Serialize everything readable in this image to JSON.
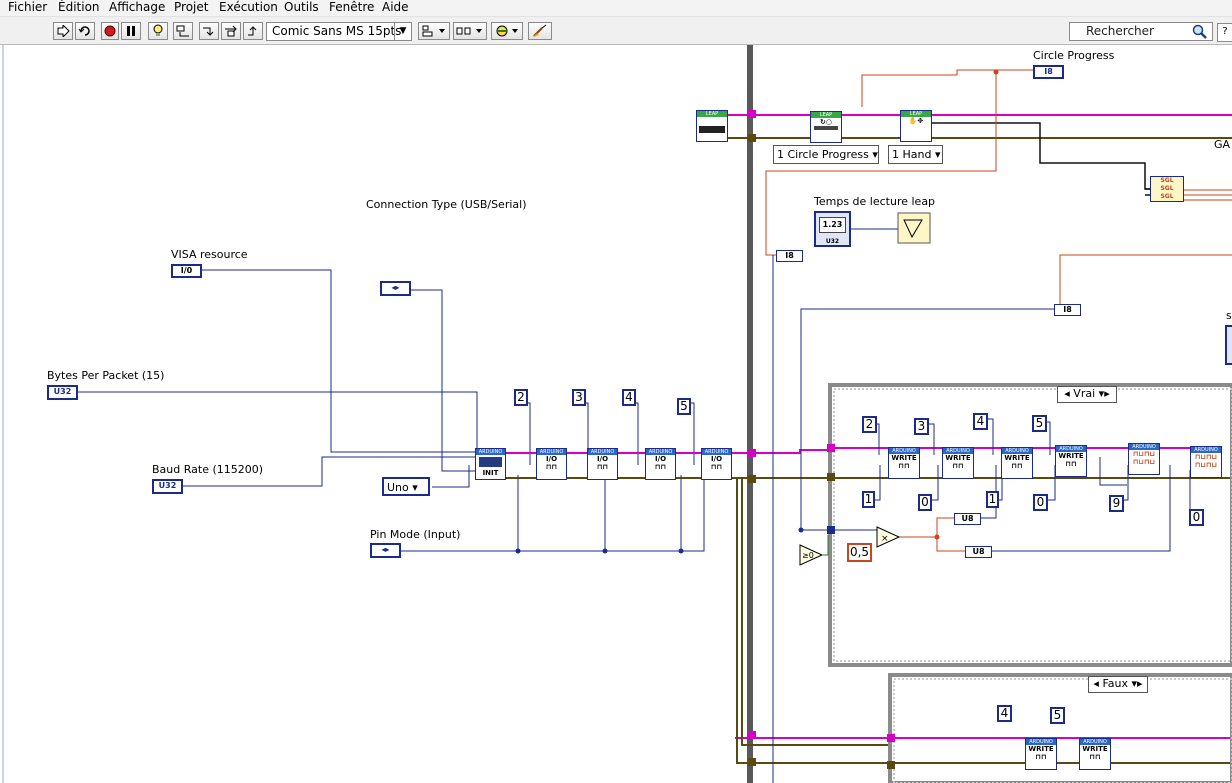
{
  "menu": [
    "Fichier",
    "Édition",
    "Affichage",
    "Projet",
    "Exécution",
    "Outils",
    "Fenêtre",
    "Aide"
  ],
  "toolbar": {
    "font_selector": "Comic Sans MS 15pts",
    "search_placeholder": "Rechercher"
  },
  "labels": {
    "connection_type": "Connection Type (USB/Serial)",
    "visa_resource": "VISA resource",
    "bytes_per_packet": "Bytes Per Packet (15)",
    "baud_rate": "Baud Rate (115200)",
    "pin_mode": "Pin Mode (Input)",
    "circle_progress": "Circle Progress",
    "temps_lecture": "Temps de lecture leap",
    "ga_partial": "GA",
    "s_partial": "s"
  },
  "terminals": {
    "io": "I/0",
    "u32": "U32",
    "i8": "I8",
    "u8": "U8",
    "sgl": "SGL",
    "numeric": "1.23"
  },
  "rings": {
    "board": "Uno",
    "circle_ring": "1 Circle Progress",
    "hand_ring": "1 Hand",
    "case_true": "Vrai",
    "case_false": "Faux"
  },
  "constants": {
    "left_pins": [
      "2",
      "3",
      "4",
      "5"
    ],
    "write_pins": [
      "2",
      "3",
      "4",
      "5"
    ],
    "write_values": [
      "1",
      "0",
      "1",
      "0"
    ],
    "nine": "9",
    "zero": "0",
    "half": "0,5",
    "false_pins": [
      "4",
      "5"
    ]
  },
  "vi_labels": {
    "init": "INIT",
    "io": "I/O",
    "write": "WRITE",
    "leap": "LEAP",
    "arduino": "ARDUINO"
  },
  "colors": {
    "wire_blue": "#1a2b8c",
    "wire_pink": "#d400c8",
    "wire_orange": "#c8461e",
    "frame_grey": "#808080",
    "wire_black": "#111111"
  }
}
